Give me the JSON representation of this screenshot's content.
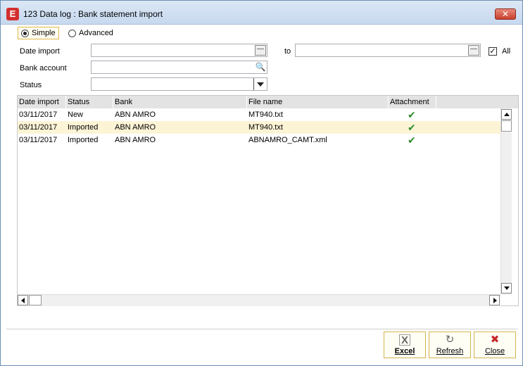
{
  "window": {
    "title": "123 Data log : Bank statement import",
    "app_icon": "E",
    "close_glyph": "✕"
  },
  "mode": {
    "simple_label": "Simple",
    "advanced_label": "Advanced",
    "selected": "Simple"
  },
  "filters": {
    "date_import_label": "Date import",
    "date_import_from": "",
    "to_label": "to",
    "date_import_to": "",
    "all_label": "All",
    "all_checked": true,
    "bank_account_label": "Bank account",
    "bank_account_value": "",
    "status_label": "Status",
    "status_value": ""
  },
  "grid": {
    "columns": [
      "Date import",
      "Status",
      "Bank",
      "File name",
      "Attachment"
    ],
    "rows": [
      {
        "date": "03/11/2017",
        "status": "New",
        "bank": "ABN AMRO",
        "file": "MT940.txt",
        "attachment": "✔"
      },
      {
        "date": "03/11/2017",
        "status": "Imported",
        "bank": "ABN AMRO",
        "file": "MT940.txt",
        "attachment": "✔"
      },
      {
        "date": "03/11/2017",
        "status": "Imported",
        "bank": "ABN AMRO",
        "file": "ABNAMRO_CAMT.xml",
        "attachment": "✔"
      }
    ],
    "selected_row": 1
  },
  "buttons": {
    "excel": {
      "label": "Excel",
      "icon": "excel-icon"
    },
    "refresh": {
      "label": "Refresh",
      "icon": "refresh-icon"
    },
    "close": {
      "label": "Close",
      "icon": "close-icon"
    }
  },
  "colors": {
    "accent": "#d32f2f",
    "selected_row": "#fdf4d6",
    "tick": "#2e8b2e"
  }
}
